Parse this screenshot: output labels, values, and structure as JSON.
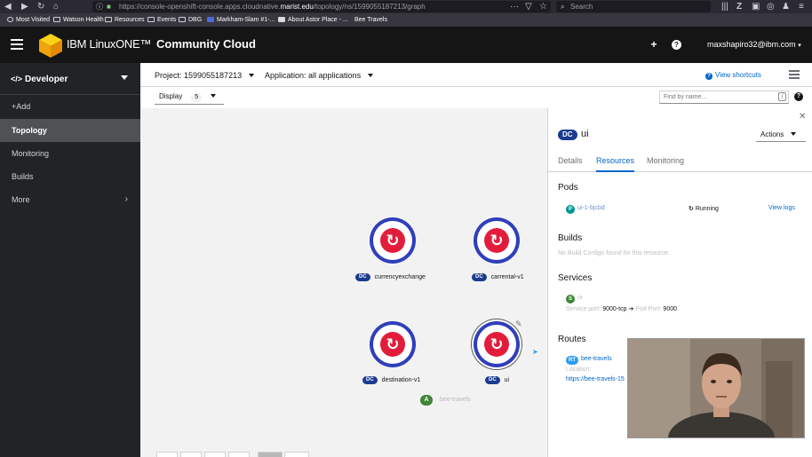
{
  "browser": {
    "url_prefix": "https://console-openshift-console.apps.cloudnative.",
    "url_domain": "marist.edu",
    "url_suffix": "/topology/ns/1599055187213/graph",
    "search_placeholder": "Search",
    "bookmarks": [
      "Most Visited",
      "Watson Health",
      "Resources",
      "Events",
      "DBG",
      "Markham-Slam #1-...",
      "About Astor Place - ...",
      "Bee Travels"
    ]
  },
  "masthead": {
    "brand_ibm": "IBM LinuxONE™",
    "brand_cc": "Community Cloud",
    "user": "maxshapiro32@ibm.com"
  },
  "sidebar": {
    "perspective": "Developer",
    "items": [
      {
        "label": "+Add"
      },
      {
        "label": "Topology"
      },
      {
        "label": "Monitoring"
      },
      {
        "label": "Builds"
      },
      {
        "label": "More"
      }
    ]
  },
  "project_bar": {
    "project": "Project: 1599055187213",
    "application": "Application: all applications",
    "shortcuts": "View shortcuts"
  },
  "toolbar": {
    "display_label": "Display",
    "display_count": "5",
    "find_placeholder": "Find by name...",
    "slash_key": "/"
  },
  "topology": {
    "dc_badge": "DC",
    "nodes": [
      {
        "name": "currencyexchange"
      },
      {
        "name": "carrental-v1"
      },
      {
        "name": "destination-v1"
      },
      {
        "name": "ui"
      }
    ],
    "app_badge": "A",
    "app_name": "bee-travels"
  },
  "panel": {
    "dc_badge": "DC",
    "title": "ui",
    "actions": "Actions",
    "tabs": [
      "Details",
      "Resources",
      "Monitoring"
    ],
    "pods_title": "Pods",
    "pod_badge": "P",
    "pod_name": "ui-1-bjcbd",
    "pod_status": "Running",
    "view_logs": "View logs",
    "builds_title": "Builds",
    "builds_text": "No Build Configs found for this resource.",
    "services_title": "Services",
    "svc_badge": "S",
    "svc_name": "ui",
    "svc_port_label": "Service port:",
    "svc_port": "9000-tcp",
    "pod_port_label": "Pod Port:",
    "pod_port": "9000",
    "routes_title": "Routes",
    "route_badge": "RT",
    "route_name": "bee-travels",
    "location_label": "Location:",
    "location_url": "https://bee-travels-15"
  },
  "colors": {
    "masthead": "#151515",
    "sidebar": "#212427",
    "node_ring": "#2f3fba",
    "node_logo": "#e21d3b",
    "link": "#0066cc"
  }
}
